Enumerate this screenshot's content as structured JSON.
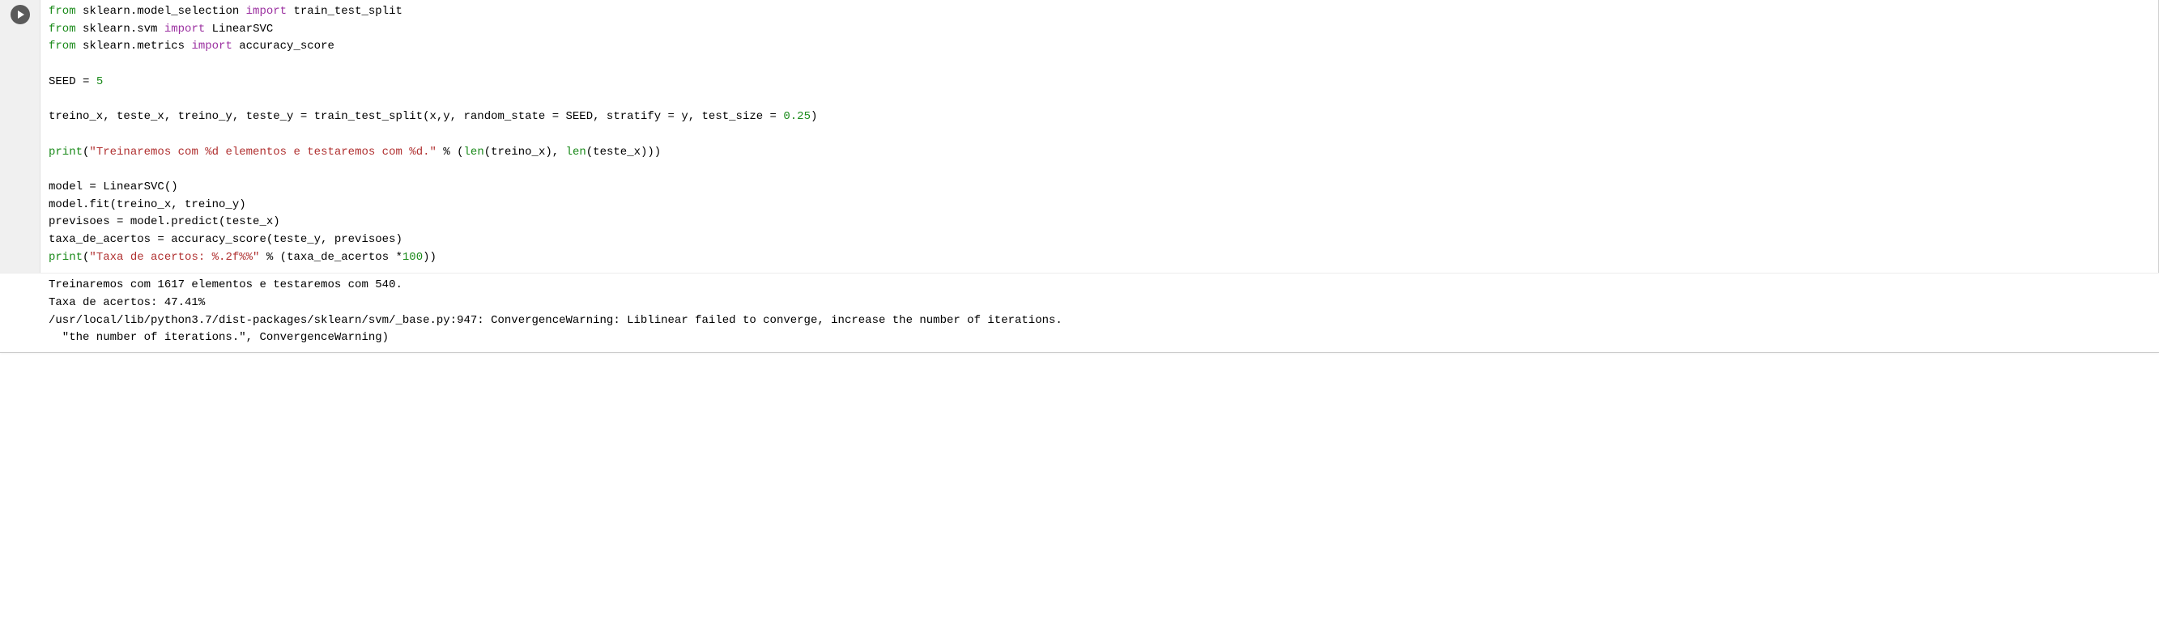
{
  "code": {
    "lines": [
      [
        {
          "t": "from ",
          "c": "kw-from"
        },
        {
          "t": "sklearn.model_selection ",
          "c": ""
        },
        {
          "t": "import ",
          "c": "kw-import"
        },
        {
          "t": "train_test_split",
          "c": ""
        }
      ],
      [
        {
          "t": "from ",
          "c": "kw-from"
        },
        {
          "t": "sklearn.svm ",
          "c": ""
        },
        {
          "t": "import ",
          "c": "kw-import"
        },
        {
          "t": "LinearSVC",
          "c": ""
        }
      ],
      [
        {
          "t": "from ",
          "c": "kw-from"
        },
        {
          "t": "sklearn.metrics ",
          "c": ""
        },
        {
          "t": "import ",
          "c": "kw-import"
        },
        {
          "t": "accuracy_score",
          "c": ""
        }
      ],
      [
        {
          "t": "",
          "c": ""
        }
      ],
      [
        {
          "t": "SEED = ",
          "c": ""
        },
        {
          "t": "5",
          "c": "kw-num"
        }
      ],
      [
        {
          "t": "",
          "c": ""
        }
      ],
      [
        {
          "t": "treino_x, teste_x, treino_y, teste_y = train_test_split(x,y, random_state = SEED, stratify = y, test_size = ",
          "c": ""
        },
        {
          "t": "0.25",
          "c": "kw-num"
        },
        {
          "t": ")",
          "c": ""
        }
      ],
      [
        {
          "t": "",
          "c": ""
        }
      ],
      [
        {
          "t": "print",
          "c": "kw-print"
        },
        {
          "t": "(",
          "c": ""
        },
        {
          "t": "\"Treinaremos com %d elementos e testaremos com %d.\"",
          "c": "kw-str"
        },
        {
          "t": " % (",
          "c": ""
        },
        {
          "t": "len",
          "c": "kw-builtin"
        },
        {
          "t": "(treino_x), ",
          "c": ""
        },
        {
          "t": "len",
          "c": "kw-builtin"
        },
        {
          "t": "(teste_x)))",
          "c": ""
        }
      ],
      [
        {
          "t": "",
          "c": ""
        }
      ],
      [
        {
          "t": "model = LinearSVC()",
          "c": ""
        }
      ],
      [
        {
          "t": "model.fit(treino_x, treino_y)",
          "c": ""
        }
      ],
      [
        {
          "t": "previsoes = model.predict(teste_x)",
          "c": ""
        }
      ],
      [
        {
          "t": "taxa_de_acertos = accuracy_score(teste_y, previsoes)",
          "c": ""
        }
      ],
      [
        {
          "t": "print",
          "c": "kw-print"
        },
        {
          "t": "(",
          "c": ""
        },
        {
          "t": "\"Taxa de acertos: %.2f%%\"",
          "c": "kw-str"
        },
        {
          "t": " % (taxa_de_acertos *",
          "c": ""
        },
        {
          "t": "100",
          "c": "kw-num"
        },
        {
          "t": "))",
          "c": ""
        }
      ]
    ]
  },
  "output": {
    "lines": [
      "Treinaremos com 1617 elementos e testaremos com 540.",
      "Taxa de acertos: 47.41%",
      "/usr/local/lib/python3.7/dist-packages/sklearn/svm/_base.py:947: ConvergenceWarning: Liblinear failed to converge, increase the number of iterations.",
      "  \"the number of iterations.\", ConvergenceWarning)"
    ]
  }
}
